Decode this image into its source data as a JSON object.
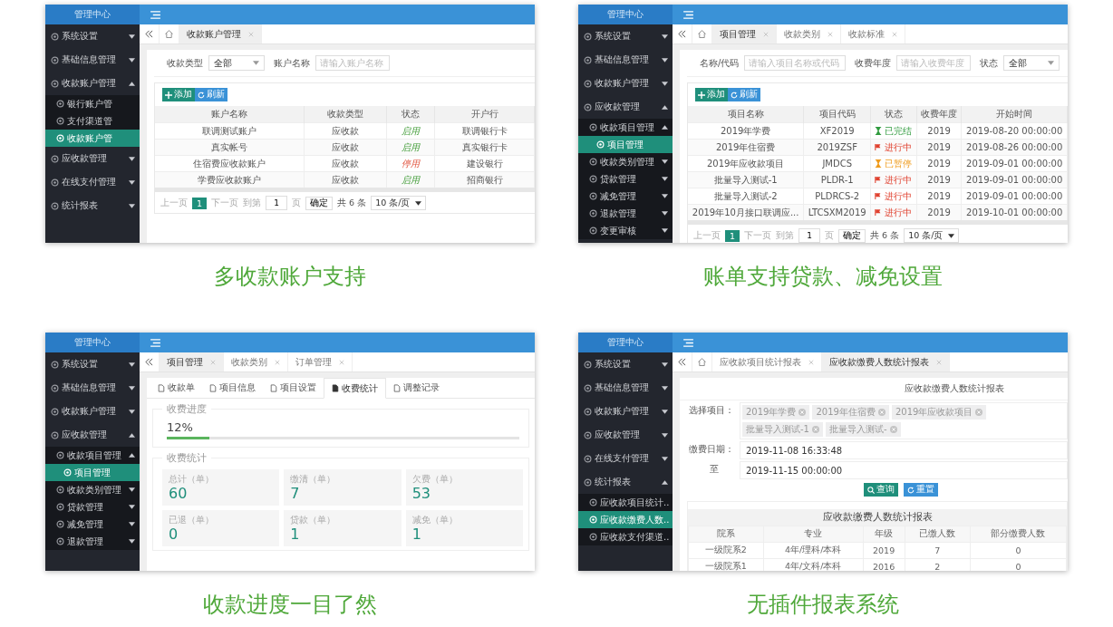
{
  "panels": [
    {
      "brand": "管理中心",
      "home_button": true,
      "menu": [
        {
          "label": "系统设置",
          "selected": false,
          "expanded": false
        },
        {
          "label": "基础信息管理",
          "selected": false,
          "expanded": false
        },
        {
          "label": "收款账户管理",
          "selected": false,
          "expanded": true,
          "children": [
            {
              "label": "银行账户管",
              "selected": false
            },
            {
              "label": "支付渠道管",
              "selected": false
            },
            {
              "label": "收款账户管",
              "selected": true
            }
          ]
        },
        {
          "label": "应收款管理",
          "selected": false,
          "expanded": false
        },
        {
          "label": "在线支付管理",
          "selected": false,
          "expanded": false
        },
        {
          "label": "统计报表",
          "selected": false,
          "expanded": false
        }
      ],
      "tabs": [
        {
          "label": "收款账户管理",
          "selected": true
        }
      ],
      "content": {
        "kind": "list",
        "filters": [
          {
            "label": "收款类型",
            "kind": "select",
            "value": "全部"
          },
          {
            "label": "账户名称",
            "kind": "input",
            "placeholder": "请输入账户名称"
          }
        ],
        "toolbar": [
          {
            "label": "添加",
            "kind": "add"
          },
          {
            "label": "刷新",
            "kind": "refresh"
          }
        ],
        "columns": [
          "账户名称",
          "收款类型",
          "状态",
          "开户行"
        ],
        "rows": [
          {
            "cells": [
              "联调测试账户",
              "应收款",
              {
                "label": "启用",
                "kind": "enabled"
              },
              "联调银行卡"
            ]
          },
          {
            "cells": [
              "真实帐号",
              "应收款",
              {
                "label": "启用",
                "kind": "enabled"
              },
              "真实银行卡"
            ]
          },
          {
            "cells": [
              "住宿费应收款账户",
              "应收款",
              {
                "label": "停用",
                "kind": "disabled"
              },
              "建设银行"
            ]
          },
          {
            "cells": [
              "学费应收款账户",
              "应收款",
              {
                "label": "启用",
                "kind": "enabled"
              },
              "招商银行"
            ]
          }
        ],
        "pagination": {
          "prev": "上一页",
          "pages": [
            {
              "label": "1",
              "selected": true
            }
          ],
          "next": "下一页",
          "goto_label": "到第",
          "goto_value": "1",
          "page_unit": "页",
          "confirm": "确定",
          "total": "共 6 条",
          "page_size": "10 条/页"
        }
      },
      "caption": "多收款账户支持"
    },
    {
      "brand": "管理中心",
      "home_button": true,
      "menu": [
        {
          "label": "系统设置",
          "selected": false,
          "expanded": false
        },
        {
          "label": "基础信息管理",
          "selected": false,
          "expanded": false
        },
        {
          "label": "收款账户管理",
          "selected": false,
          "expanded": false
        },
        {
          "label": "应收款管理",
          "selected": false,
          "expanded": true,
          "children": [
            {
              "label": "收款项目管理",
              "selected": false,
              "expanded": true,
              "children": [
                {
                  "label": "项目管理",
                  "selected": true
                }
              ]
            },
            {
              "label": "收款类别管理",
              "selected": false,
              "expanded": false
            },
            {
              "label": "贷款管理",
              "selected": false,
              "expanded": false
            },
            {
              "label": "减免管理",
              "selected": false,
              "expanded": false
            },
            {
              "label": "退款管理",
              "selected": false,
              "expanded": false
            },
            {
              "label": "变更审核",
              "selected": false,
              "expanded": false
            }
          ]
        }
      ],
      "tabs": [
        {
          "label": "项目管理",
          "selected": true
        },
        {
          "label": "收款类别",
          "selected": false
        },
        {
          "label": "收款标准",
          "selected": false
        }
      ],
      "content": {
        "kind": "list",
        "filters": [
          {
            "label": "名称/代码",
            "kind": "input",
            "placeholder": "请输入项目名称或代码"
          },
          {
            "label": "收费年度",
            "kind": "input",
            "placeholder": "请输入收费年度"
          },
          {
            "label": "状态",
            "kind": "select",
            "value": "全部"
          }
        ],
        "toolbar": [
          {
            "label": "添加",
            "kind": "add"
          },
          {
            "label": "刷新",
            "kind": "refresh"
          }
        ],
        "columns": [
          "项目名称",
          "项目代码",
          "状态",
          "收费年度",
          "开始时间"
        ],
        "rows": [
          {
            "cells": [
              "2019年学费",
              "XF2019",
              {
                "label": "已完结",
                "kind": "finished"
              },
              "2019",
              "2019-08-20 00:00:00"
            ]
          },
          {
            "cells": [
              "2019年住宿费",
              "2019ZSF",
              {
                "label": "进行中",
                "kind": "running"
              },
              "2019",
              "2019-08-26 00:00:00"
            ]
          },
          {
            "cells": [
              "2019年应收款项目",
              "JMDCS",
              {
                "label": "已暂停",
                "kind": "paused"
              },
              "2019",
              "2019-09-01 00:00:00"
            ]
          },
          {
            "cells": [
              "批量导入测试-1",
              "PLDR-1",
              {
                "label": "进行中",
                "kind": "running"
              },
              "2019",
              "2019-09-01 00:00:00"
            ]
          },
          {
            "cells": [
              "批量导入测试-2",
              "PLDRCS-2",
              {
                "label": "进行中",
                "kind": "running"
              },
              "2019",
              "2019-09-01 00:00:00"
            ]
          },
          {
            "cells": [
              "2019年10月接口联调应...",
              "LTCSXM2019",
              {
                "label": "进行中",
                "kind": "running"
              },
              "2019",
              "2019-10-01 00:00:00"
            ]
          }
        ],
        "pagination": {
          "prev": "上一页",
          "pages": [
            {
              "label": "1",
              "selected": true
            }
          ],
          "next": "下一页",
          "goto_label": "到第",
          "goto_value": "1",
          "page_unit": "页",
          "confirm": "确定",
          "total": "共 6 条",
          "page_size": "10 条/页"
        }
      },
      "caption": "账单支持贷款、减免设置"
    },
    {
      "brand": "管理中心",
      "home_button": false,
      "menu": [
        {
          "label": "系统设置",
          "selected": false,
          "expanded": false
        },
        {
          "label": "基础信息管理",
          "selected": false,
          "expanded": false
        },
        {
          "label": "收款账户管理",
          "selected": false,
          "expanded": false
        },
        {
          "label": "应收款管理",
          "selected": false,
          "expanded": true,
          "children": [
            {
              "label": "收款项目管理",
              "selected": false,
              "expanded": true,
              "children": [
                {
                  "label": "项目管理",
                  "selected": true
                }
              ]
            },
            {
              "label": "收款类别管理",
              "selected": false,
              "expanded": false
            },
            {
              "label": "贷款管理",
              "selected": false,
              "expanded": false
            },
            {
              "label": "减免管理",
              "selected": false,
              "expanded": false
            },
            {
              "label": "退款管理",
              "selected": false,
              "expanded": false
            }
          ]
        }
      ],
      "tabs": [
        {
          "label": "项目管理",
          "selected": true
        },
        {
          "label": "收款类别",
          "selected": false
        },
        {
          "label": "订单管理",
          "selected": false
        }
      ],
      "content": {
        "kind": "stats",
        "subtabs": [
          {
            "label": "收款单",
            "selected": false
          },
          {
            "label": "项目信息",
            "selected": false
          },
          {
            "label": "项目设置",
            "selected": false
          },
          {
            "label": "收费统计",
            "selected": true
          },
          {
            "label": "调整记录",
            "selected": false
          }
        ],
        "progress": {
          "title": "收费进度",
          "percent": "12%",
          "level": 0.12
        },
        "stats_title": "收费统计",
        "stats": [
          {
            "label": "总计（单）",
            "value": "60"
          },
          {
            "label": "缴清（单）",
            "value": "7"
          },
          {
            "label": "欠费（单）",
            "value": "53"
          },
          {
            "label": "已退（单）",
            "value": "0"
          },
          {
            "label": "贷款（单）",
            "value": "1"
          },
          {
            "label": "减免（单）",
            "value": "1"
          }
        ]
      },
      "caption": "收款进度一目了然"
    },
    {
      "brand": "管理中心",
      "home_button": true,
      "menu": [
        {
          "label": "系统设置",
          "selected": false,
          "expanded": false
        },
        {
          "label": "基础信息管理",
          "selected": false,
          "expanded": false
        },
        {
          "label": "收款账户管理",
          "selected": false,
          "expanded": false
        },
        {
          "label": "应收款管理",
          "selected": false,
          "expanded": false
        },
        {
          "label": "在线支付管理",
          "selected": false,
          "expanded": false
        },
        {
          "label": "统计报表",
          "selected": false,
          "expanded": true,
          "children": [
            {
              "label": "应收款项目统计..",
              "selected": false
            },
            {
              "label": "应收款缴费人数..",
              "selected": true
            },
            {
              "label": "应收款支付渠道..",
              "selected": false
            }
          ]
        }
      ],
      "tabs": [
        {
          "label": "应收款项目统计报表",
          "selected": false
        },
        {
          "label": "应收款缴费人数统计报表",
          "selected": true
        }
      ],
      "content": {
        "kind": "report",
        "title": "应收款缴费人数统计报表",
        "project_label": "选择项目：",
        "projects": [
          "2019年学费",
          "2019年住宿费",
          "2019年应收款项目",
          "批量导入测试-1",
          "批量导入测试-"
        ],
        "date_label": "缴费日期：",
        "date_from": "2019-11-08 16:33:48",
        "to_label": "至",
        "date_to": "2019-11-15 00:00:00",
        "buttons": [
          {
            "label": "查询",
            "kind": "search"
          },
          {
            "label": "重置",
            "kind": "reset"
          }
        ],
        "table": {
          "title": "应收款缴费人数统计报表",
          "columns": [
            "院系",
            "专业",
            "年级",
            "已缴人数",
            "部分缴费人数"
          ],
          "rows": [
            [
              "一级院系2",
              "4年/理科/本科",
              "2019",
              "7",
              "0"
            ],
            [
              "一级院系1",
              "4年/文科/本科",
              "2016",
              "2",
              "0"
            ]
          ]
        }
      },
      "caption": "无插件报表系统"
    }
  ]
}
